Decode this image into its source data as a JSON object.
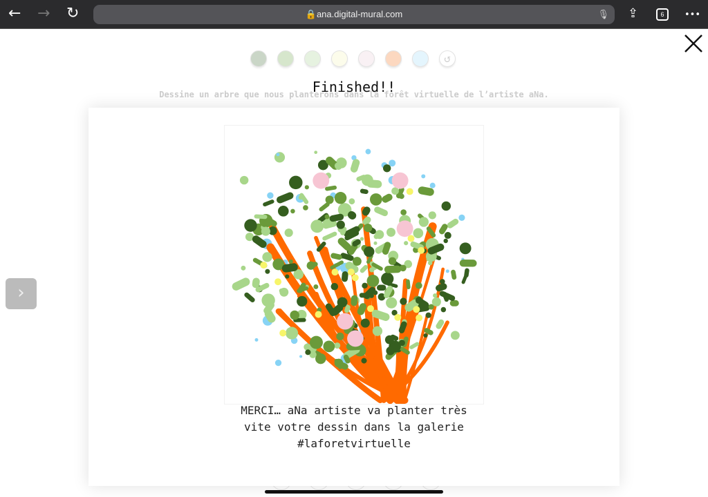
{
  "browser": {
    "url": "ana.digital-mural.com",
    "tab_count": "6",
    "back": "←",
    "forward": "→",
    "reload": "↻",
    "share": "⇪",
    "more": "•••"
  },
  "palette": {
    "colors": [
      "#9fb59a",
      "#b5d3a4",
      "#d2e8c8",
      "#fbfadc",
      "#f5e6ec",
      "#fbb98e",
      "#cfeefc"
    ],
    "undo_icon": "↺"
  },
  "title": "Finished!!",
  "subtitle": "Dessine un arbre que nous planterons dans la forêt virtuelle de l’artiste aNa.",
  "message": {
    "line1": "MERCI… aNa artiste va planter très",
    "line2": "vite votre dessin dans la galerie",
    "line3": "#laforetvirtuelle"
  },
  "side_button": "›",
  "drawing_colors": {
    "trunk": "#ff6a00",
    "dark_green": "#355e1f",
    "mid_green": "#6a9a3a",
    "light_green": "#a8d68a",
    "blue": "#87d3f5",
    "pink": "#f7c5d3",
    "yellow": "#f7f56a"
  }
}
